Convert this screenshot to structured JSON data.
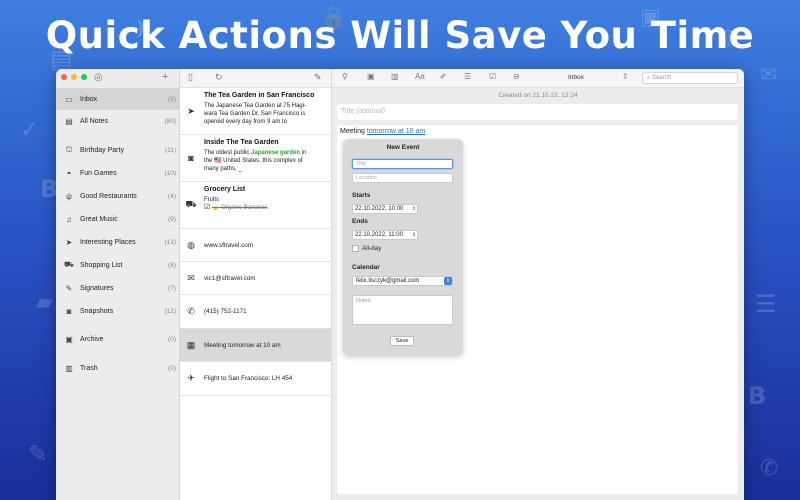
{
  "headline": "Quick Actions Will Save You Time",
  "colors": {
    "accent": "#2a70d8",
    "green_highlight": "#2ba32b",
    "bg_top": "#3f7fe0",
    "bg_bottom": "#1a2f9a"
  },
  "sidebar": {
    "add_icon": "plus-icon",
    "items": [
      {
        "icon": "inbox-icon",
        "label": "Inbox",
        "count": "(8)"
      },
      {
        "icon": "notes-icon",
        "label": "All Notes",
        "count": "(80)"
      },
      {
        "icon": "cake-icon",
        "label": "Birthday Party",
        "count": "(11)"
      },
      {
        "icon": "gamepad-icon",
        "label": "Fun Games",
        "count": "(10)"
      },
      {
        "icon": "cutlery-icon",
        "label": "Good Restaurants",
        "count": "(4)"
      },
      {
        "icon": "music-icon",
        "label": "Great Music",
        "count": "(9)"
      },
      {
        "icon": "location-arrow-icon",
        "label": "Interesting Places",
        "count": "(13)"
      },
      {
        "icon": "cart-icon",
        "label": "Shopping List",
        "count": "(6)"
      },
      {
        "icon": "pen-icon",
        "label": "Signatures",
        "count": "(7)"
      },
      {
        "icon": "camera-icon",
        "label": "Snapshots",
        "count": "(12)"
      },
      {
        "icon": "archive-icon",
        "label": "Archive",
        "count": "(0)"
      },
      {
        "icon": "trash-icon",
        "label": "Trash",
        "count": "(0)"
      }
    ]
  },
  "notes": {
    "n1": {
      "title": "The Tea Garden in San Francisco",
      "line1": "The Japanese Tea Garden at 75 Hagi-",
      "line2": "wara Tea Garden Dr, San Francisco is",
      "line3": "opened every day from 9 am to"
    },
    "n2": {
      "title": "Inside The Tea Garden",
      "pre": "The oldest public ",
      "highlight": "Japanese garden",
      "post": " in",
      "line2": "the 🇺🇸 United States, this complex of",
      "line3": "many paths, _"
    },
    "n3": {
      "title": "Grocery List",
      "line1": "Fruits",
      "item": "🍌 Organic Bananas"
    },
    "n4": {
      "text": "www.sftravel.com"
    },
    "n5": {
      "text": "vic1@sftravel.com"
    },
    "n6": {
      "text": "(415) 752-1171"
    },
    "n7": {
      "text": "Meeting tomorrow at 10 am"
    },
    "n8": {
      "text": "Flight to San Francisco: LH 454"
    }
  },
  "editor": {
    "toolbar_title": "Inbox",
    "search_placeholder": "Search",
    "created": "Created on 21.10.22, 12:24",
    "title_placeholder": "Title (optional)",
    "body_prefix": "Meeting ",
    "body_link": "tomorrow at 10 am"
  },
  "event": {
    "heading": "New Event",
    "title_placeholder": "Title",
    "location_placeholder": "Location",
    "starts_label": "Starts",
    "starts_value": "22.10.2022, 10:00",
    "ends_label": "Ends",
    "ends_value": "22.10.2022, 11:00",
    "allday_label": "All-day",
    "calendar_label": "Calendar",
    "calendar_value": "felix.lisczyk@gmail.com",
    "notes_placeholder": "Notes",
    "save_label": "Save"
  }
}
